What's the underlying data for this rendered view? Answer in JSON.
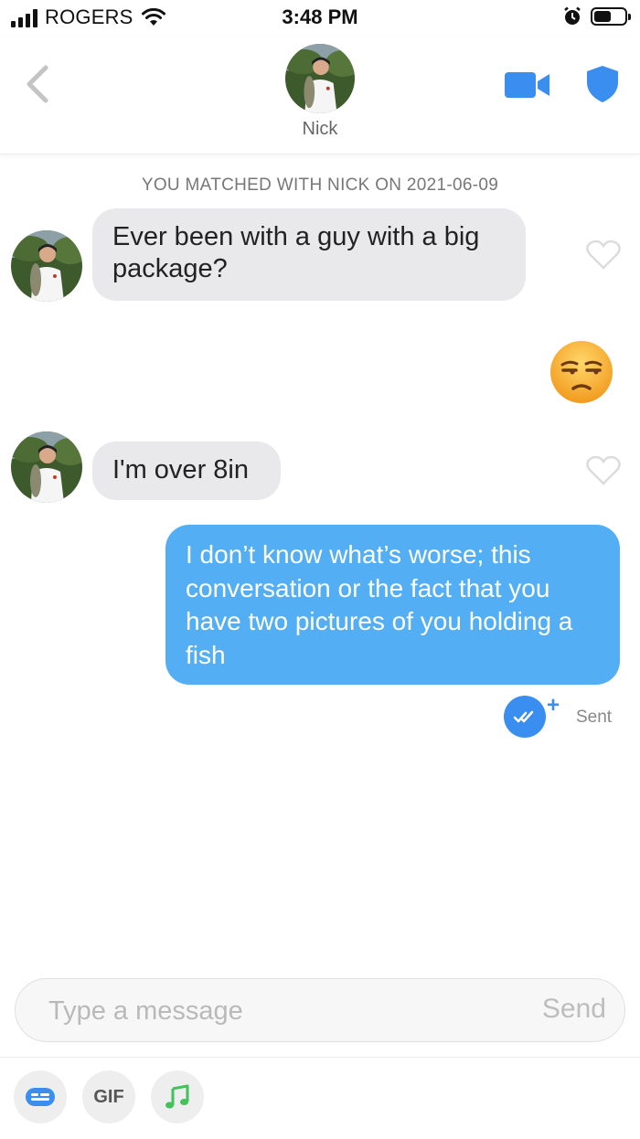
{
  "status_bar": {
    "carrier": "ROGERS",
    "time": "3:48 PM",
    "icons": [
      "signal-icon",
      "wifi-icon",
      "alarm-icon",
      "battery-icon"
    ],
    "battery_level": 0.55
  },
  "header": {
    "contact_name": "Nick",
    "icons": [
      "back-chevron-icon",
      "video-camera-icon",
      "shield-icon"
    ],
    "accent_color": "#3a8ef0"
  },
  "conversation": {
    "match_note": "YOU MATCHED WITH NICK ON 2021-06-09",
    "messages": [
      {
        "from": "them",
        "text": "Ever been with a guy with a big package?"
      },
      {
        "from": "me",
        "emoji": "unamused-face"
      },
      {
        "from": "them",
        "text": "I'm over 8in"
      },
      {
        "from": "me",
        "text": "I don’t know what’s worse; this conversation or the fact that you have two pictures of you holding a fish"
      }
    ],
    "status": {
      "read_icon": "double-check-icon",
      "plus": "+",
      "label": "Sent"
    },
    "incoming_bubble_color": "#e9e9ec",
    "outgoing_bubble_color": "#53aef4"
  },
  "composer": {
    "placeholder": "Type a message",
    "value": "",
    "send_label": "Send",
    "tools": [
      {
        "name": "sticker-icon"
      },
      {
        "name": "gif-button",
        "label": "GIF"
      },
      {
        "name": "music-note-icon"
      }
    ]
  }
}
